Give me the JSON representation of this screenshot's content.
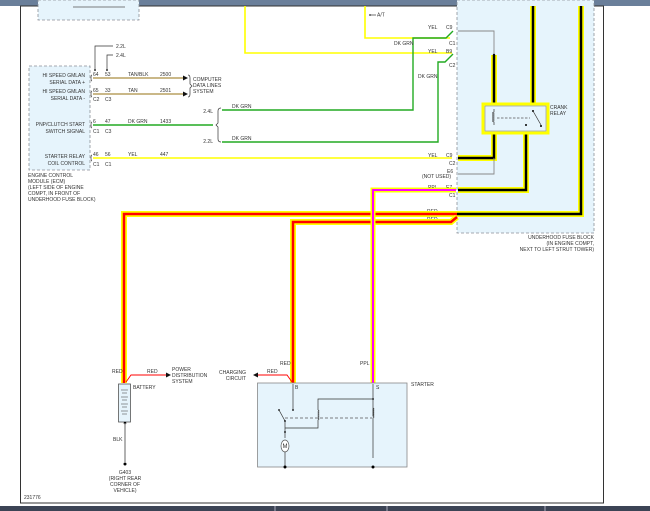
{
  "colors": {
    "yel": "#ffff00",
    "dk_grn": "#22aa22",
    "tan": "#b8a060",
    "red": "#ff0000",
    "ppl": "#ff00ff",
    "blk": "#888888",
    "module_fill": "#e6f4fc",
    "highlight": "#ffff00"
  },
  "top": {
    "at": "A/T"
  },
  "ecm": {
    "rows": [
      {
        "l1": "HI SPEED GMLAN",
        "l2": "SERIAL DATA +",
        "p1": "64",
        "p2": "53",
        "c1": "",
        "c2": "",
        "wire": "TAN/BLK",
        "circuit": "2500"
      },
      {
        "l1": "HI SPEED GMLAN",
        "l2": "SERIAL DATA -",
        "p1": "65",
        "p2": "33",
        "c1": "C2",
        "c2": "C3",
        "wire": "TAN",
        "circuit": "2501"
      },
      {
        "l1": "PNP/CLUTCH START",
        "l2": "SWITCH SIGNAL",
        "p1": "6",
        "p2": "47",
        "c1": "C1",
        "c2": "C3",
        "wire": "DK GRN",
        "circuit": "1433"
      },
      {
        "l1": "STARTER RELAY",
        "l2": "COIL CONTROL",
        "p1": "46",
        "p2": "56",
        "c1": "C1",
        "c2": "C1",
        "wire": "YEL",
        "circuit": "447"
      }
    ],
    "engine_22": "2.2L",
    "engine_24": "2.4L",
    "caption": [
      "ENGINE CONTROL",
      "MODULE (ECM)",
      "(LEFT SIDE OF ENGINE",
      "COMPT, IN FRONT OF",
      "UNDERHOOD FUSE BLOCK)"
    ]
  },
  "computer_data": [
    "COMPUTER",
    "DATA LINES",
    "SYSTEM"
  ],
  "brace": {
    "top": "2.4L",
    "bottom": "2.2L",
    "wire": "DK GRN"
  },
  "fuse_block": {
    "pins": {
      "yel": "YEL",
      "c9": "C9",
      "c1": "C1",
      "c2": "C2",
      "b9": "B9",
      "dkgrn": "DK GRN",
      "e6": "E6",
      "not_used": "(NOT USED)",
      "ppl": "PPL",
      "e7": "E7",
      "red": "RED"
    },
    "relay": [
      "CRANK",
      "RELAY"
    ],
    "caption": [
      "UNDERHOOD FUSE BLOCK",
      "(IN ENGINE COMPT,",
      "NEXT TO LEFT STRUT TOWER)"
    ]
  },
  "battery": {
    "label": "BATTERY",
    "red": "RED",
    "blk": "BLK",
    "pds": [
      "POWER",
      "DISTRIBUTION",
      "SYSTEM"
    ],
    "ground": "G403",
    "ground_loc": [
      "(RIGHT REAR",
      "CORNER OF",
      "VEHICLE)"
    ]
  },
  "starter": {
    "label": "STARTER",
    "b": "B",
    "s": "S",
    "red": "RED",
    "ppl": "PPL",
    "motor": "M",
    "charging": [
      "CHARGING",
      "CIRCUIT"
    ]
  },
  "figure_id": "231776"
}
